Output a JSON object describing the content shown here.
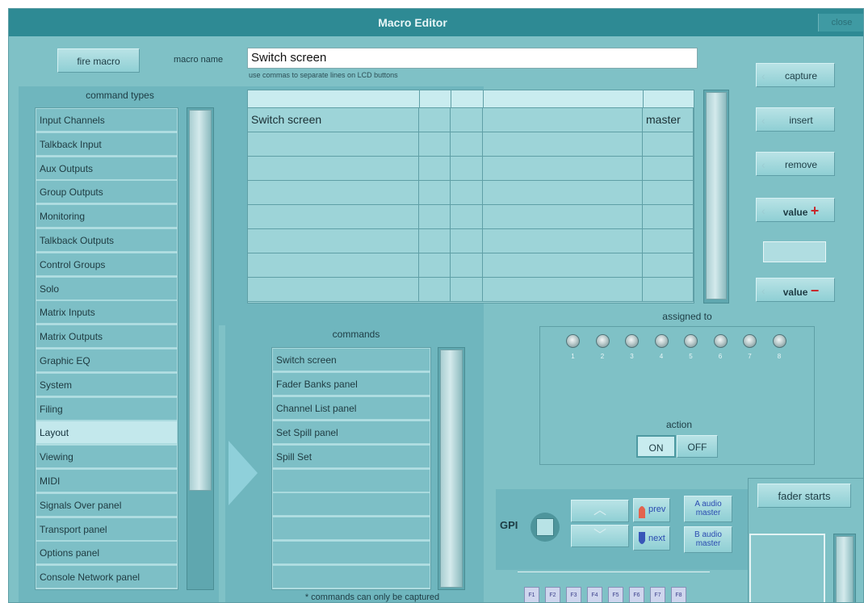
{
  "window": {
    "title": "Macro Editor",
    "close_label": "close"
  },
  "top": {
    "fire_macro_label": "fire macro",
    "macro_name_label": "macro name",
    "macro_name_value": "Switch screen",
    "hint": "use commas to separate lines on LCD buttons"
  },
  "command_types": {
    "title": "command types",
    "items": [
      "Input Channels",
      "Talkback Input",
      "Aux Outputs",
      "Group Outputs",
      "Monitoring",
      "Talkback Outputs",
      "Control Groups",
      "Solo",
      "Matrix Inputs",
      "Matrix Outputs",
      "Graphic EQ",
      "System",
      "Filing",
      "Layout",
      "Viewing",
      "MIDI",
      "Signals Over panel",
      "Transport panel",
      "Options panel",
      "Console Network panel"
    ],
    "selected": "Layout"
  },
  "macro_lines": {
    "rows": [
      [
        "Switch screen",
        "",
        "",
        "",
        "master"
      ],
      [
        "",
        "",
        "",
        "",
        ""
      ],
      [
        "",
        "",
        "",
        "",
        ""
      ],
      [
        "",
        "",
        "",
        "",
        ""
      ],
      [
        "",
        "",
        "",
        "",
        ""
      ],
      [
        "",
        "",
        "",
        "",
        ""
      ],
      [
        "",
        "",
        "",
        "",
        ""
      ],
      [
        "",
        "",
        "",
        "",
        ""
      ]
    ]
  },
  "commands": {
    "title": "commands",
    "items": [
      "Switch screen",
      "Fader Banks panel",
      "Channel List panel",
      "Set Spill panel",
      "Spill Set",
      "",
      "",
      "",
      "",
      ""
    ],
    "footnote": "* commands can only be captured"
  },
  "side_buttons": {
    "capture": "capture",
    "insert": "insert",
    "remove": "remove",
    "value_up": "value",
    "value_down": "value",
    "value_display": ""
  },
  "assigned": {
    "label": "assigned to",
    "numbers": [
      "1",
      "2",
      "3",
      "4",
      "5",
      "6",
      "7",
      "8"
    ],
    "action_label": "action",
    "on_label": "ON",
    "off_label": "OFF",
    "selected_action": "ON"
  },
  "gpi": {
    "label": "GPI",
    "prev_label": "prev",
    "next_label": "next",
    "a_audio_master": "A audio master",
    "b_audio_master": "B audio master"
  },
  "fader_starts": {
    "label": "fader starts"
  },
  "fkeys": [
    "F1",
    "F2",
    "F3",
    "F4",
    "F5",
    "F6",
    "F7",
    "F8"
  ],
  "colors": {
    "accent": "#2e8a94",
    "panel": "#7fc1c6",
    "plus_minus": "#c8282c"
  }
}
